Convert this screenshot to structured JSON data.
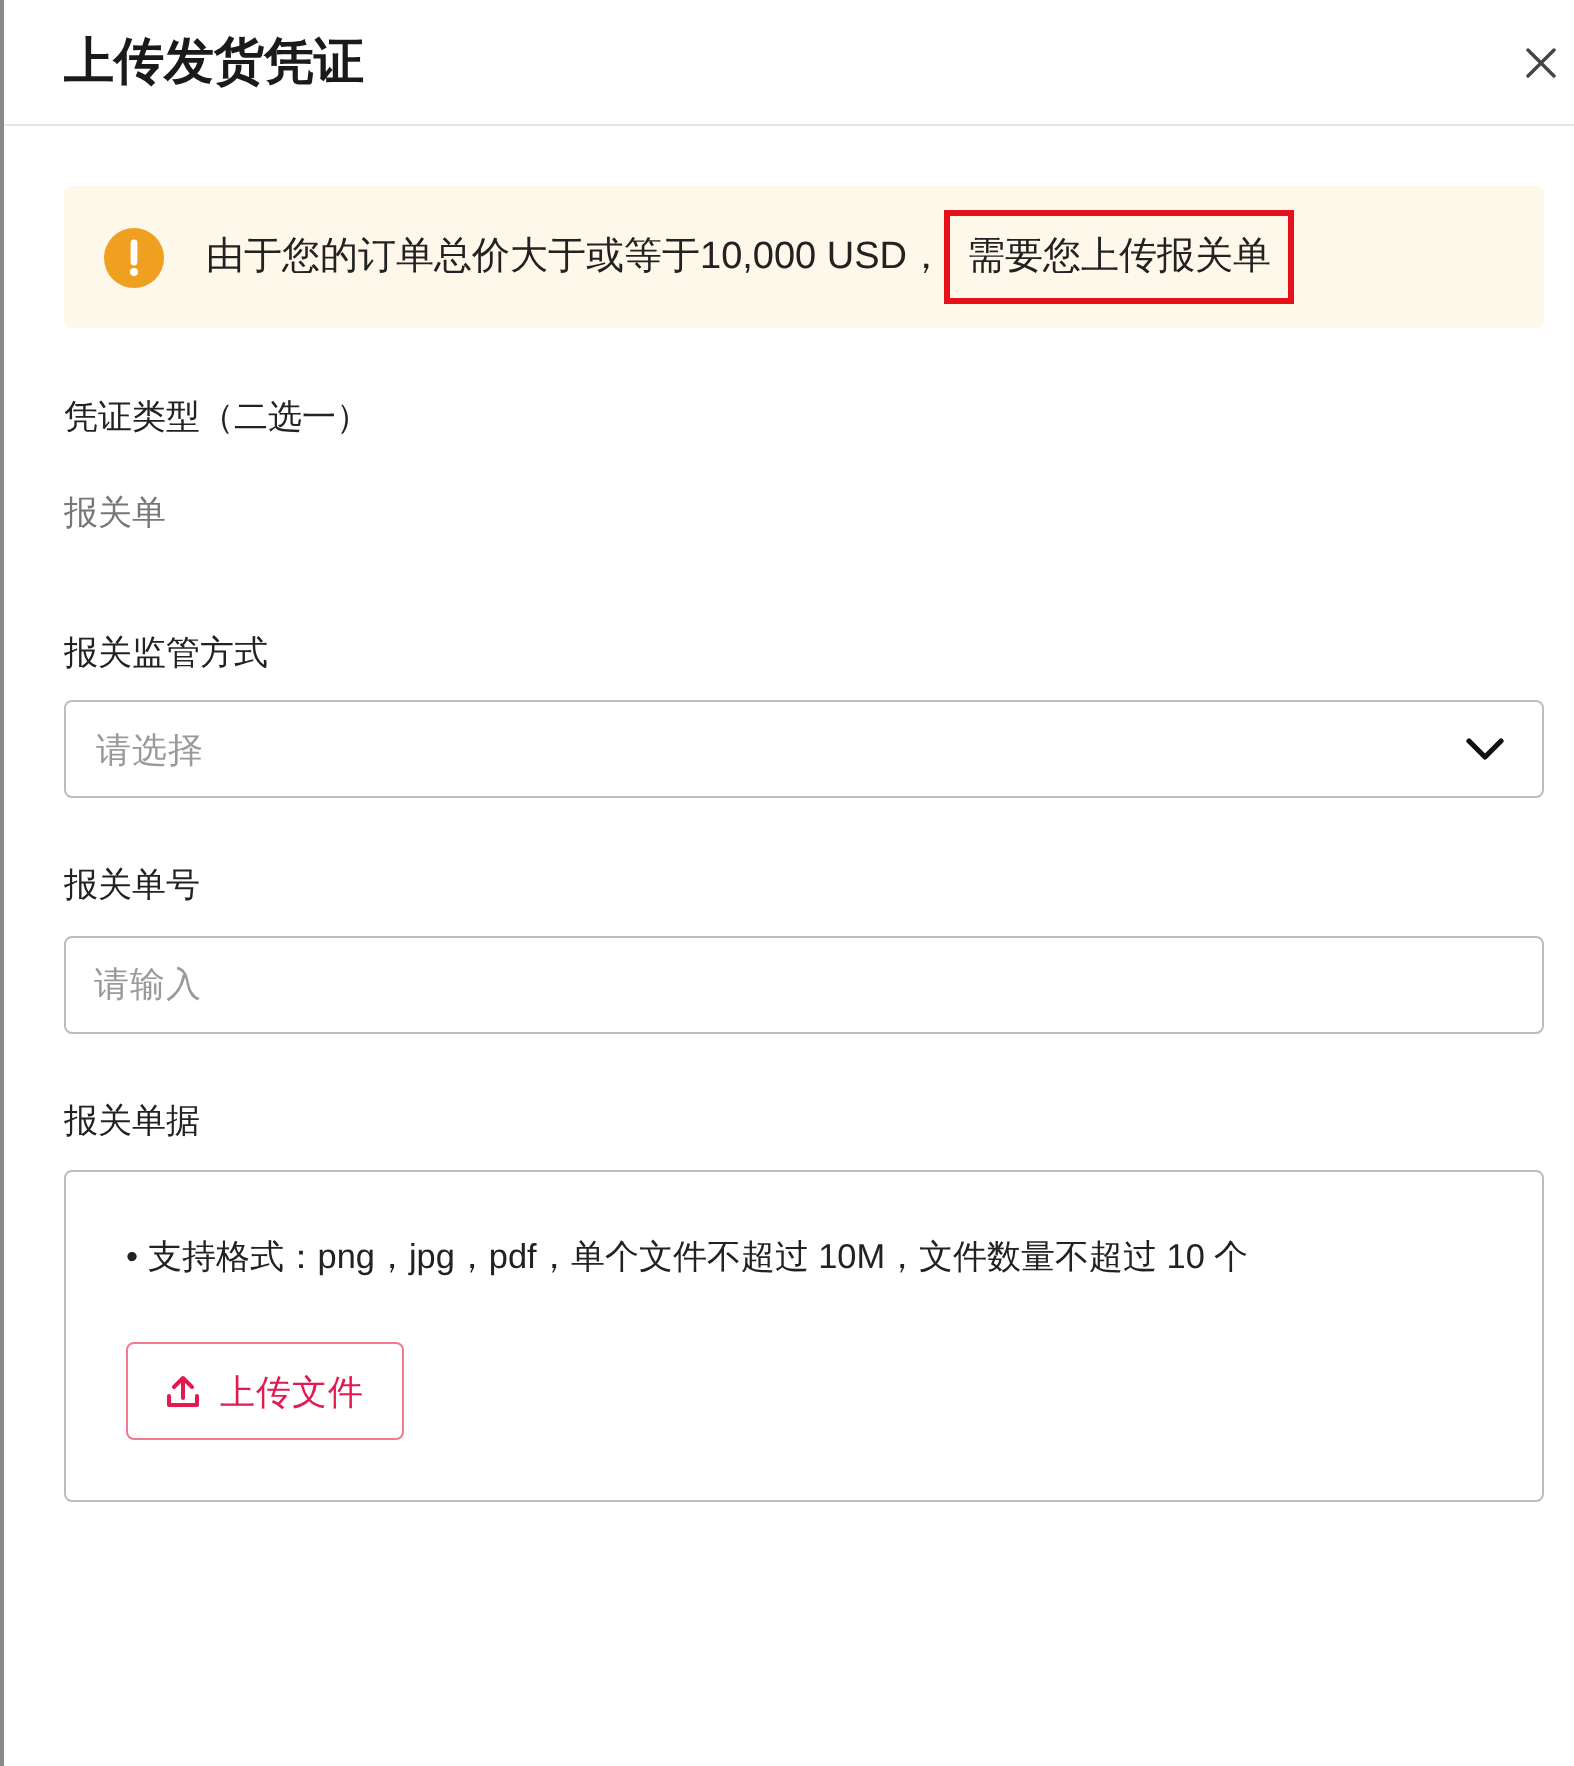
{
  "drawer": {
    "title": "上传发货凭证"
  },
  "alert": {
    "parts": [
      {
        "text": "由于您的订单总价大于或等于10,000 USD，",
        "highlighted": false
      },
      {
        "text": "需要您上传报关单",
        "highlighted": true
      }
    ]
  },
  "voucher_type": {
    "label": "凭证类型（二选一）",
    "value": "报关单"
  },
  "fields": [
    {
      "kind": "select",
      "label": "报关监管方式",
      "placeholder": "请选择"
    },
    {
      "kind": "input",
      "label": "报关单号",
      "placeholder": "请输入"
    },
    {
      "kind": "upload",
      "label": "报关单据",
      "hint": "• 支持格式：png，jpg，pdf，单个文件不超过 10M，文件数量不超过 10 个",
      "button": "上传文件"
    }
  ]
}
